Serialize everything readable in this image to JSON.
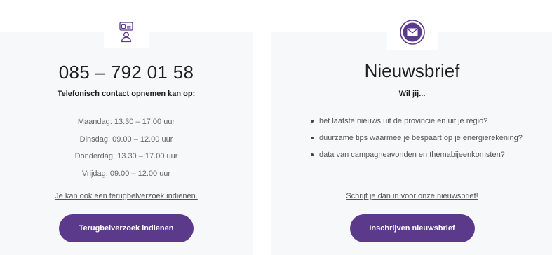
{
  "contact": {
    "icon": "contact-person-icon",
    "phone": "085 – 792 01 58",
    "subhead": "Telefonisch contact opnemen kan op:",
    "hours": [
      "Maandag: 13.30 – 17.00 uur",
      "Dinsdag: 09.00 – 12.00 uur",
      "Donderdag: 13.30 – 17.00 uur",
      "Vrijdag: 09.00 – 12.00 uur"
    ],
    "link_text": "Je kan ook een terugbelverzoek indienen.",
    "button_label": "Terugbelverzoek indienen"
  },
  "newsletter": {
    "icon": "envelope-icon",
    "title": "Nieuwsbrief",
    "subhead": "Wil jij...",
    "bullets": [
      "het laatste nieuws uit de provincie en uit je regio?",
      "duurzame tips waarmee je bespaart op je energierekening?",
      "data van campagneavonden en themabijeenkomsten?"
    ],
    "link_text": "Schrijf je dan in voor onze nieuwsbrief!",
    "button_label": "Inschrijven nieuwsbrief"
  },
  "colors": {
    "accent": "#5b3a8c",
    "card_bg": "#f7f8f9",
    "text": "#1f1f1f"
  }
}
